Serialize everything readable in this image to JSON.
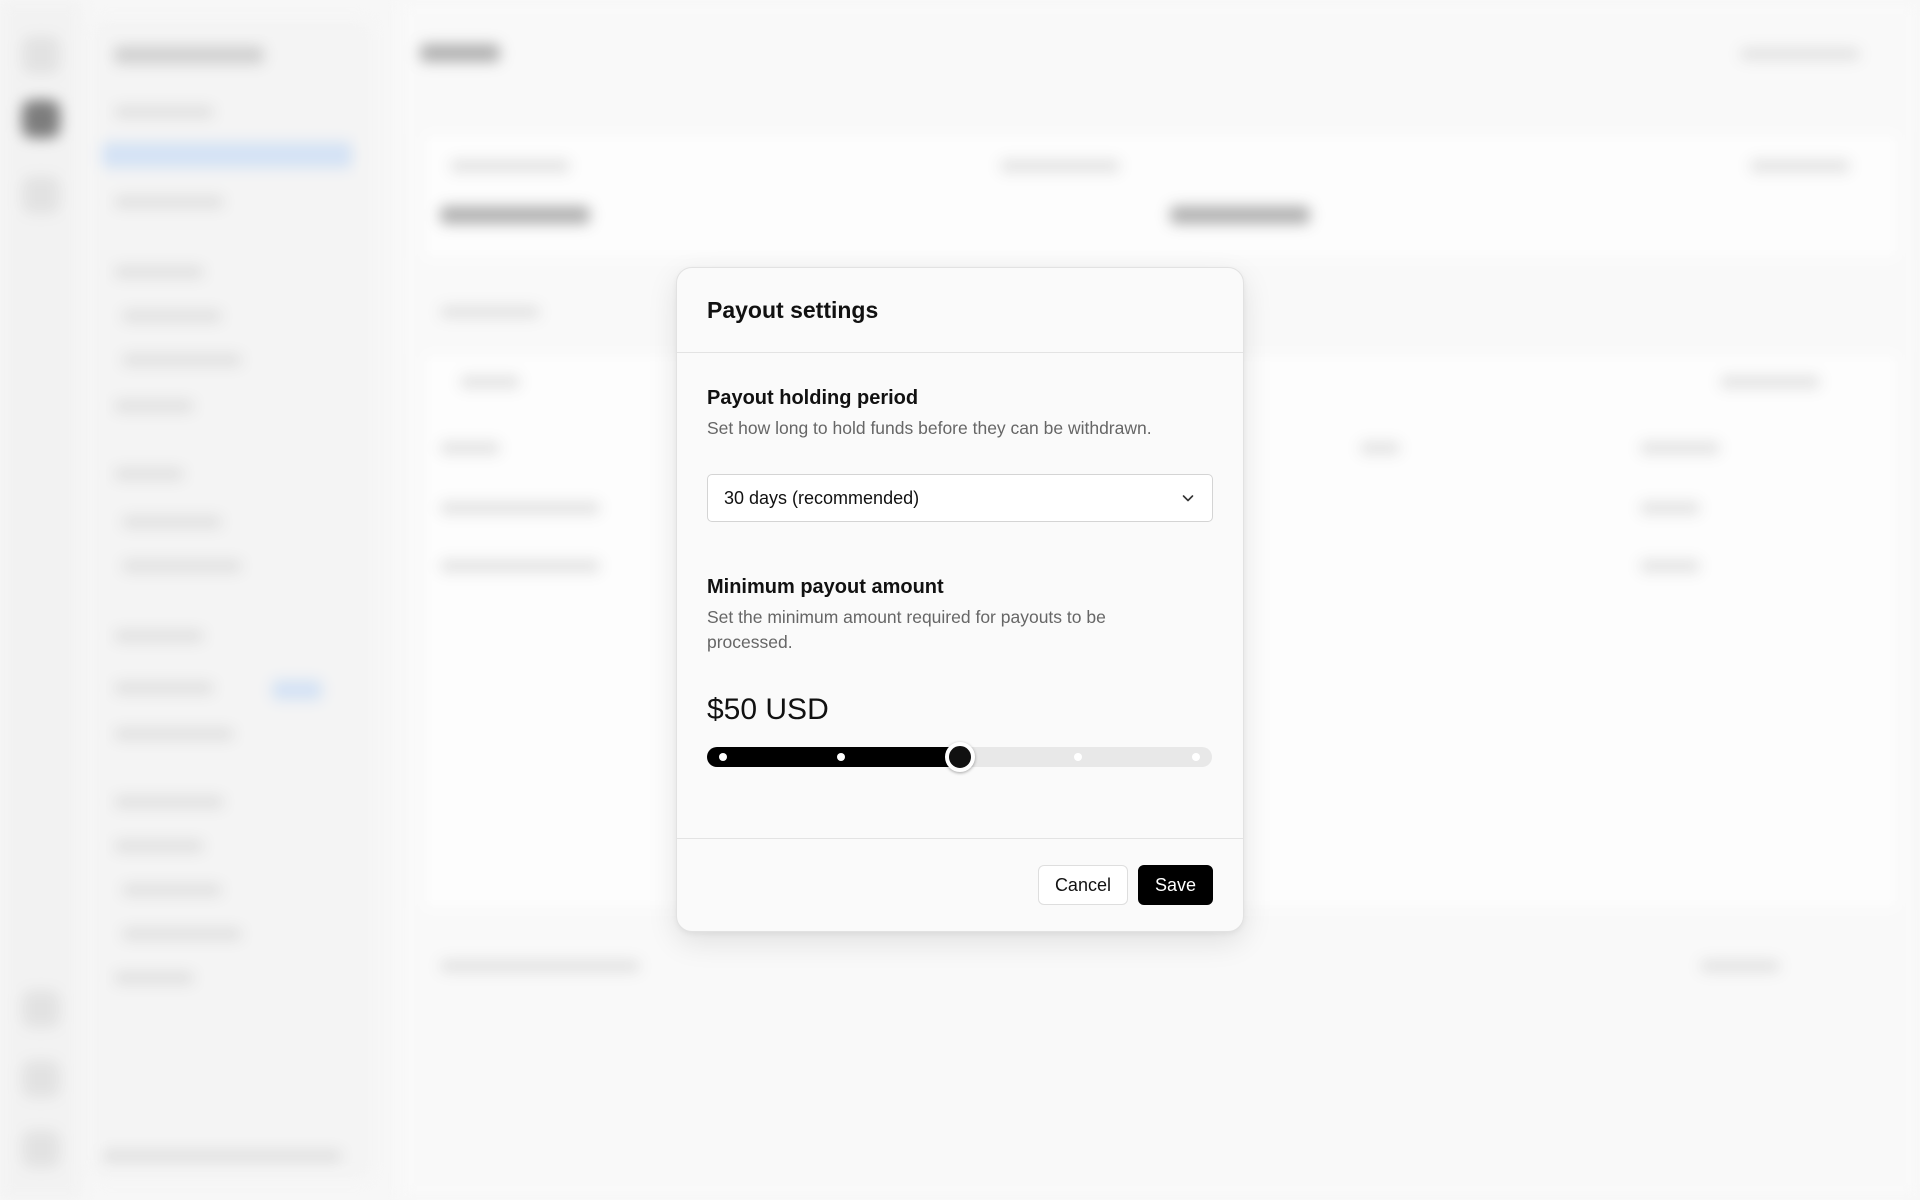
{
  "modal": {
    "title": "Payout settings",
    "holding": {
      "title": "Payout holding period",
      "description": "Set how long to hold funds before they can be withdrawn.",
      "selected_value": "30 days (recommended)"
    },
    "minimum": {
      "title": "Minimum payout amount",
      "description": "Set the minimum amount required for payouts to be processed.",
      "amount_display": "$50 USD",
      "slider_value_fraction": 0.5,
      "slider_steps": 4
    },
    "footer": {
      "cancel_label": "Cancel",
      "save_label": "Save"
    }
  },
  "icons": {
    "select": "chevron-down-icon"
  },
  "colors": {
    "primary": "#000000",
    "slider_track": "#e8e8e8"
  }
}
